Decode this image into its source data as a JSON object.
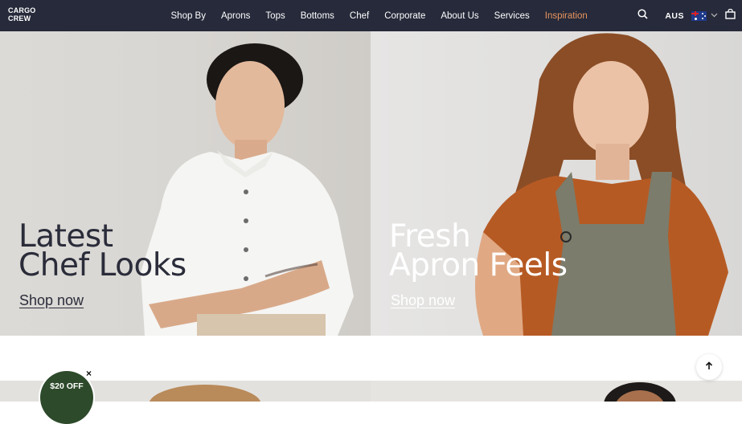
{
  "brand": {
    "logo_line1": "CARGO",
    "logo_line2": "CREW"
  },
  "nav": {
    "items": [
      {
        "label": "Shop By"
      },
      {
        "label": "Aprons"
      },
      {
        "label": "Tops"
      },
      {
        "label": "Bottoms"
      },
      {
        "label": "Chef"
      },
      {
        "label": "Corporate"
      },
      {
        "label": "About Us"
      },
      {
        "label": "Services"
      },
      {
        "label": "Inspiration"
      }
    ],
    "country": "AUS",
    "icons": [
      "search-icon",
      "flag-au-icon",
      "chevron-down-icon",
      "bag-icon"
    ]
  },
  "hero": {
    "left": {
      "line1": "Latest",
      "line2": "Chef Looks",
      "cta": "Shop now"
    },
    "right": {
      "line1": "Fresh",
      "line2": "Apron Feels",
      "cta": "Shop now"
    }
  },
  "promo": {
    "label": "$20 OFF",
    "close": "×"
  },
  "colors": {
    "nav_bg": "#262a3a",
    "accent": "#e8955f",
    "promo_bg": "#2d4a2a"
  }
}
